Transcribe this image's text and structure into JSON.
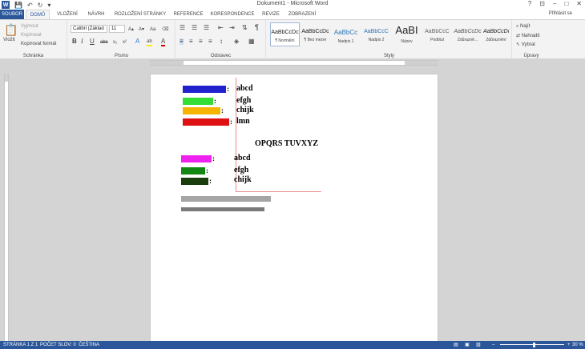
{
  "window": {
    "title": "Dokument1 - Microsoft Word",
    "quick_access": {
      "save": "💾",
      "undo": "↶",
      "redo": "↻",
      "customize": "▾"
    },
    "controls": {
      "help": "?",
      "ribbon_options": "⊡",
      "minimize": "–",
      "restore": "□",
      "close": "✕"
    }
  },
  "tabs": {
    "file": "SOUBOR",
    "items": [
      "DOMŮ",
      "VLOŽENÍ",
      "NÁVRH",
      "ROZLOŽENÍ STRÁNKY",
      "REFERENCE",
      "KORESPONDENCE",
      "REVIZE",
      "ZOBRAZENÍ"
    ],
    "active": "DOMŮ",
    "login": "Přihlásit se"
  },
  "ribbon": {
    "clipboard": {
      "label": "Schránka",
      "paste": "Vložit",
      "cut": "Vyjmout",
      "copy": "Kopírovat",
      "format_painter": "Kopírovat formát"
    },
    "font": {
      "label": "Písmo",
      "font_name": "Calibri (Základ",
      "font_size": "11",
      "bold": "B",
      "italic": "I",
      "underline": "U",
      "strike": "abc",
      "subscript": "x₂",
      "superscript": "x²",
      "grow": "A▴",
      "shrink": "A▾",
      "case": "Aa",
      "clear": "⌫",
      "highlight": "ab",
      "color": "A",
      "effects": "A"
    },
    "paragraph": {
      "label": "Odstavec",
      "pilcrow": "¶"
    },
    "styles": {
      "label": "Styly",
      "items": [
        {
          "sample": "AaBbCcDc",
          "name": "¶ Normální"
        },
        {
          "sample": "AaBbCcDc",
          "name": "¶ Bez mezer"
        },
        {
          "sample": "AaBbCc",
          "name": "Nadpis 1"
        },
        {
          "sample": "AaBbCcC",
          "name": "Nadpis 2"
        },
        {
          "sample": "AaBI",
          "name": "Název"
        },
        {
          "sample": "AaBbCcC",
          "name": "Podtitul"
        },
        {
          "sample": "AaBbCcDc",
          "name": "Zdůrazně..."
        },
        {
          "sample": "AaBbCcDc",
          "name": "Zdůraznění"
        }
      ]
    },
    "editing": {
      "label": "Úpravy",
      "find": "Najít",
      "replace": "Nahradit",
      "select": "Vybrat"
    }
  },
  "document": {
    "heading": "OPQRS TUVXYZ",
    "rows_top": [
      {
        "color": "#2222cc",
        "word": "abcd"
      },
      {
        "color": "#33dd33",
        "word": "efgh"
      },
      {
        "color": "#f5b400",
        "word": "chijk"
      },
      {
        "color": "#dd1111",
        "word": "lmn"
      }
    ],
    "rows_bottom": [
      {
        "color": "#ee22ee",
        "word": "abcd"
      },
      {
        "color": "#118811",
        "word": "efgh"
      },
      {
        "color": "#1a3d0d",
        "word": "chijk"
      }
    ],
    "colon": ":"
  },
  "status": {
    "page": "STRÁNKA 1 Z 1",
    "words": "POČET SLOV: 0",
    "lang": "ČEŠTINA",
    "zoom": "30 %",
    "zoom_minus": "–",
    "zoom_plus": "+",
    "view_read": "▤",
    "view_print": "▣",
    "view_web": "▥"
  },
  "colors": {
    "accent": "#2b579a",
    "ribbon_bg": "#f3f3f3",
    "canvas": "#d4d4d4"
  }
}
